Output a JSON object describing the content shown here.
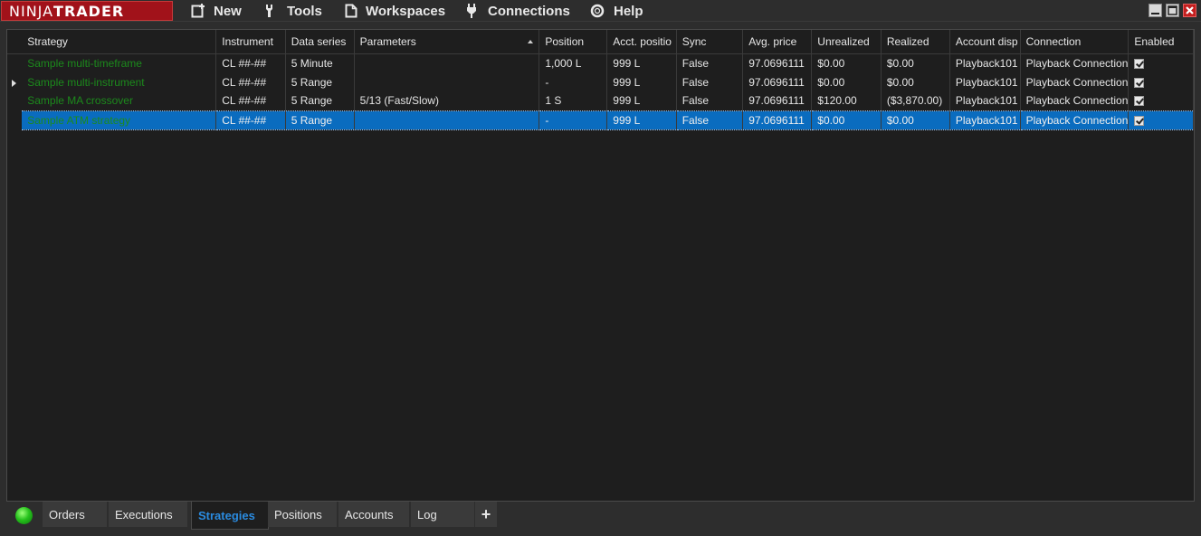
{
  "app": {
    "logo_part1": "NINJA",
    "logo_part2": "TRADER"
  },
  "menu": [
    {
      "label": "New",
      "icon": "new-icon"
    },
    {
      "label": "Tools",
      "icon": "wrench-icon"
    },
    {
      "label": "Workspaces",
      "icon": "document-icon"
    },
    {
      "label": "Connections",
      "icon": "plug-icon"
    },
    {
      "label": "Help",
      "icon": "lifebuoy-icon"
    }
  ],
  "columns": [
    "Strategy",
    "Instrument",
    "Data series",
    "Parameters",
    "Position",
    "Acct. positio",
    "Sync",
    "Avg. price",
    "Unrealized",
    "Realized",
    "Account disp",
    "Connection",
    "Enabled"
  ],
  "rows": [
    {
      "strategy": "Sample multi-timeframe",
      "instrument": "CL ##-##",
      "data_series": "5 Minute",
      "parameters": "",
      "position": "1,000 L",
      "acct_position": "999 L",
      "sync": "False",
      "avg_price": "97.0696111",
      "unrealized": "$0.00",
      "realized": "$0.00",
      "account": "Playback101",
      "connection": "Playback Connection",
      "enabled": true
    },
    {
      "strategy": "Sample multi-instrument",
      "instrument": "CL ##-##",
      "data_series": "5 Range",
      "parameters": "",
      "position": "-",
      "acct_position": "999 L",
      "sync": "False",
      "avg_price": "97.0696111",
      "unrealized": "$0.00",
      "realized": "$0.00",
      "account": "Playback101",
      "connection": "Playback Connection",
      "enabled": true
    },
    {
      "strategy": "Sample MA crossover",
      "instrument": "CL ##-##",
      "data_series": "5 Range",
      "parameters": "5/13 (Fast/Slow)",
      "position": "1 S",
      "acct_position": "999 L",
      "sync": "False",
      "avg_price": "97.0696111",
      "unrealized": "$120.00",
      "realized": "($3,870.00)",
      "account": "Playback101",
      "connection": "Playback Connection",
      "enabled": true
    },
    {
      "strategy": "Sample ATM strategy",
      "instrument": "CL ##-##",
      "data_series": "5 Range",
      "parameters": "",
      "position": "-",
      "acct_position": "999 L",
      "sync": "False",
      "avg_price": "97.0696111",
      "unrealized": "$0.00",
      "realized": "$0.00",
      "account": "Playback101",
      "connection": "Playback Connection",
      "enabled": true
    }
  ],
  "tabs": [
    {
      "label": "Orders"
    },
    {
      "label": "Executions"
    },
    {
      "label": "Strategies"
    },
    {
      "label": "Positions"
    },
    {
      "label": "Accounts"
    },
    {
      "label": "Log"
    },
    {
      "label": "+"
    }
  ],
  "colors": {
    "strategy_text": "#1c8a1c",
    "selection": "#0a6cbf",
    "active_tab": "#2a8be0",
    "logo_bg": "#a1121a"
  }
}
